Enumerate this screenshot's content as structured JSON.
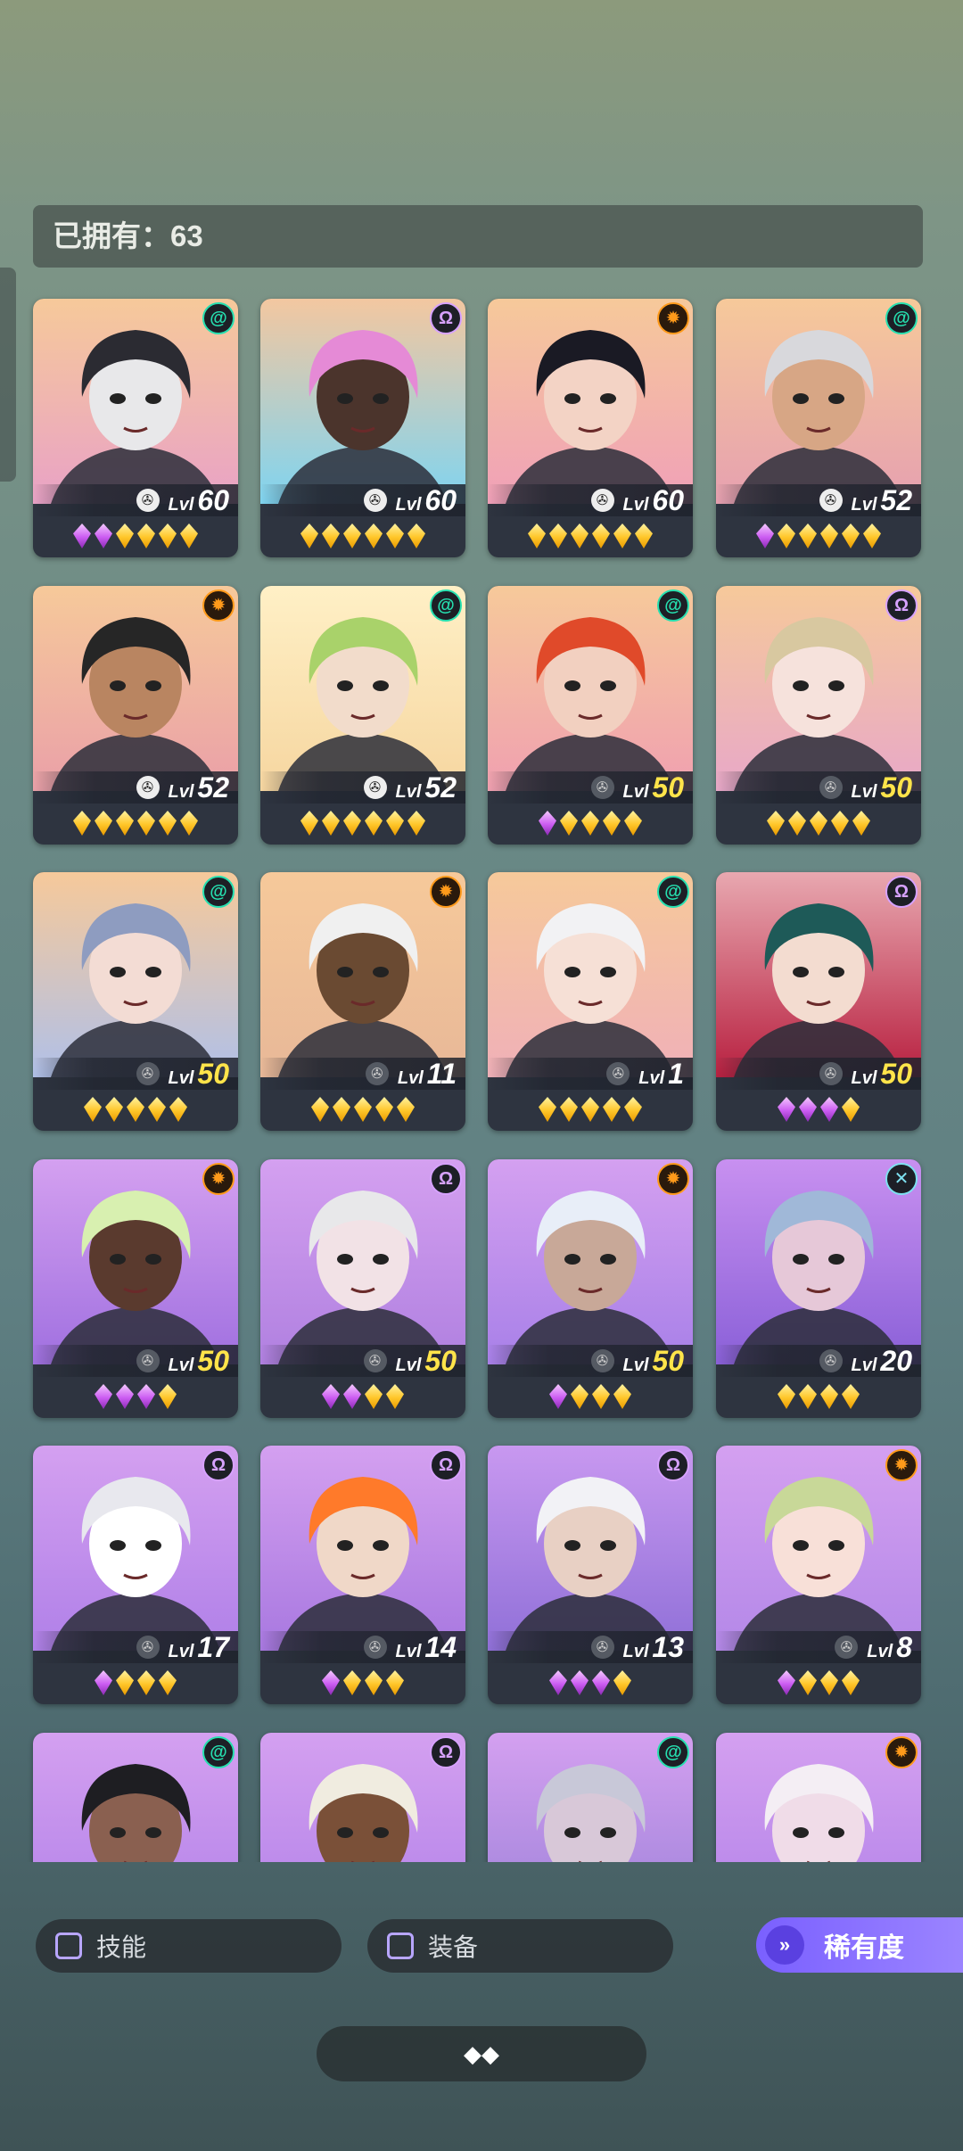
{
  "owned": {
    "label": "已拥有：",
    "count": "63"
  },
  "heroes": [
    {
      "faction": "spiral",
      "faction_color": "green",
      "level": "60",
      "lvl_label": "Lvl",
      "gold_level": false,
      "icon_active": true,
      "stars": [
        "purple",
        "purple",
        "gold",
        "gold",
        "gold",
        "gold"
      ],
      "bg": [
        "#f6c99a",
        "#e9a2c6"
      ],
      "skin": "#e8e8ea",
      "hair": "#2b2b32"
    },
    {
      "faction": "omega",
      "faction_color": "purple",
      "level": "60",
      "lvl_label": "Lvl",
      "gold_level": false,
      "icon_active": true,
      "stars": [
        "gold",
        "gold",
        "gold",
        "gold",
        "gold",
        "gold"
      ],
      "bg": [
        "#f3c7a0",
        "#7fd4f0"
      ],
      "skin": "#4b342c",
      "hair": "#e58ad6"
    },
    {
      "faction": "sun",
      "faction_color": "orange",
      "level": "60",
      "lvl_label": "Lvl",
      "gold_level": false,
      "icon_active": true,
      "stars": [
        "gold",
        "gold",
        "gold",
        "gold",
        "gold",
        "gold"
      ],
      "bg": [
        "#f6c99a",
        "#f0a0b8"
      ],
      "skin": "#f3d3c5",
      "hair": "#1a1a24"
    },
    {
      "faction": "spiral",
      "faction_color": "green",
      "level": "52",
      "lvl_label": "Lvl",
      "gold_level": false,
      "icon_active": true,
      "stars": [
        "purple",
        "gold",
        "gold",
        "gold",
        "gold",
        "gold"
      ],
      "bg": [
        "#f6c99a",
        "#e6a0b0"
      ],
      "skin": "#d7a685",
      "hair": "#d8d8dc"
    },
    {
      "faction": "sun",
      "faction_color": "orange",
      "level": "52",
      "lvl_label": "Lvl",
      "gold_level": false,
      "icon_active": true,
      "stars": [
        "gold",
        "gold",
        "gold",
        "gold",
        "gold",
        "gold"
      ],
      "bg": [
        "#f6c99a",
        "#eaa0a8"
      ],
      "skin": "#b98561",
      "hair": "#262626"
    },
    {
      "faction": "spiral",
      "faction_color": "green",
      "level": "52",
      "lvl_label": "Lvl",
      "gold_level": false,
      "icon_active": true,
      "stars": [
        "gold",
        "gold",
        "gold",
        "gold",
        "gold",
        "gold"
      ],
      "bg": [
        "#fff0c6",
        "#f6d6a0"
      ],
      "skin": "#f2dccb",
      "hair": "#a9d26a"
    },
    {
      "faction": "spiral",
      "faction_color": "green",
      "level": "50",
      "lvl_label": "Lvl",
      "gold_level": true,
      "icon_active": false,
      "stars": [
        "purple",
        "gold",
        "gold",
        "gold",
        "gold"
      ],
      "bg": [
        "#f6c99a",
        "#f0a0b0"
      ],
      "skin": "#f2d0c0",
      "hair": "#e04a2a"
    },
    {
      "faction": "omega",
      "faction_color": "purple",
      "level": "50",
      "lvl_label": "Lvl",
      "gold_level": true,
      "icon_active": false,
      "stars": [
        "gold",
        "gold",
        "gold",
        "gold",
        "gold"
      ],
      "bg": [
        "#f6c99a",
        "#e8a8c8"
      ],
      "skin": "#f6e2dc",
      "hair": "#d8c8a0"
    },
    {
      "faction": "spiral",
      "faction_color": "green",
      "level": "50",
      "lvl_label": "Lvl",
      "gold_level": true,
      "icon_active": false,
      "stars": [
        "gold",
        "gold",
        "gold",
        "gold",
        "gold"
      ],
      "bg": [
        "#f6c99a",
        "#b0c0e8"
      ],
      "skin": "#f3dcd4",
      "hair": "#8e9cc0"
    },
    {
      "faction": "sun",
      "faction_color": "orange",
      "level": "11",
      "lvl_label": "Lvl",
      "gold_level": false,
      "icon_active": false,
      "stars": [
        "gold",
        "gold",
        "gold",
        "gold",
        "gold"
      ],
      "bg": [
        "#f6c99a",
        "#e8b898"
      ],
      "skin": "#6a4a32",
      "hair": "#f0f0f0"
    },
    {
      "faction": "spiral",
      "faction_color": "green",
      "level": "1",
      "lvl_label": "Lvl",
      "gold_level": false,
      "icon_active": false,
      "stars": [
        "gold",
        "gold",
        "gold",
        "gold",
        "gold"
      ],
      "bg": [
        "#f6c99a",
        "#f0b0b8"
      ],
      "skin": "#f6e0d6",
      "hair": "#f2f2f4"
    },
    {
      "faction": "omega",
      "faction_color": "purple",
      "level": "50",
      "lvl_label": "Lvl",
      "gold_level": true,
      "icon_active": false,
      "stars": [
        "purple",
        "purple",
        "purple",
        "gold"
      ],
      "bg": [
        "#e8a8b0",
        "#b82040"
      ],
      "skin": "#f3dcd0",
      "hair": "#1e5a58"
    },
    {
      "faction": "sun",
      "faction_color": "orange",
      "level": "50",
      "lvl_label": "Lvl",
      "gold_level": true,
      "icon_active": false,
      "stars": [
        "purple",
        "purple",
        "purple",
        "gold"
      ],
      "bg": [
        "#d4a0f0",
        "#a070e0"
      ],
      "skin": "#5a3a2e",
      "hair": "#d8f0b0"
    },
    {
      "faction": "omega",
      "faction_color": "purple",
      "level": "50",
      "lvl_label": "Lvl",
      "gold_level": true,
      "icon_active": false,
      "stars": [
        "purple",
        "purple",
        "gold",
        "gold"
      ],
      "bg": [
        "#d4a0f0",
        "#b080e0"
      ],
      "skin": "#f2e2e6",
      "hair": "#e8e8ea"
    },
    {
      "faction": "sun",
      "faction_color": "orange",
      "level": "50",
      "lvl_label": "Lvl",
      "gold_level": true,
      "icon_active": false,
      "stars": [
        "purple",
        "gold",
        "gold",
        "gold"
      ],
      "bg": [
        "#d4a0f0",
        "#a880e8"
      ],
      "skin": "#c8a898",
      "hair": "#e8eef8"
    },
    {
      "faction": "cross",
      "faction_color": "teal",
      "level": "20",
      "lvl_label": "Lvl",
      "gold_level": false,
      "icon_active": false,
      "stars": [
        "gold",
        "gold",
        "gold",
        "gold"
      ],
      "bg": [
        "#c890f0",
        "#8a60d8"
      ],
      "skin": "#e6c8d8",
      "hair": "#a0b8d8"
    },
    {
      "faction": "omega",
      "faction_color": "purple",
      "level": "17",
      "lvl_label": "Lvl",
      "gold_level": false,
      "icon_active": false,
      "stars": [
        "purple",
        "gold",
        "gold",
        "gold"
      ],
      "bg": [
        "#d4a0f0",
        "#b080e8"
      ],
      "skin": "#ffffff",
      "hair": "#e8e8ee"
    },
    {
      "faction": "omega",
      "faction_color": "purple",
      "level": "14",
      "lvl_label": "Lvl",
      "gold_level": false,
      "icon_active": false,
      "stars": [
        "purple",
        "gold",
        "gold",
        "gold"
      ],
      "bg": [
        "#d4a0f0",
        "#a878e0"
      ],
      "skin": "#f0d8c8",
      "hair": "#ff7a2a"
    },
    {
      "faction": "omega",
      "faction_color": "purple",
      "level": "13",
      "lvl_label": "Lvl",
      "gold_level": false,
      "icon_active": false,
      "stars": [
        "purple",
        "purple",
        "purple",
        "gold"
      ],
      "bg": [
        "#c898f0",
        "#9070d8"
      ],
      "skin": "#e8d0c4",
      "hair": "#f2f2f6"
    },
    {
      "faction": "sun",
      "faction_color": "orange",
      "level": "8",
      "lvl_label": "Lvl",
      "gold_level": false,
      "icon_active": false,
      "stars": [
        "purple",
        "gold",
        "gold",
        "gold"
      ],
      "bg": [
        "#d4a0f0",
        "#b488e8"
      ],
      "skin": "#f8e0d8",
      "hair": "#c8d898"
    },
    {
      "faction": "spiral",
      "faction_color": "green",
      "level": "",
      "lvl_label": "",
      "gold_level": false,
      "icon_active": false,
      "stars": [],
      "bg": [
        "#d4a0f0",
        "#b080e8"
      ],
      "skin": "#8a6050",
      "hair": "#1e1e22"
    },
    {
      "faction": "omega",
      "faction_color": "purple",
      "level": "",
      "lvl_label": "",
      "gold_level": false,
      "icon_active": false,
      "stars": [],
      "bg": [
        "#d4a0f0",
        "#b080e8"
      ],
      "skin": "#7a5038",
      "hair": "#f0ece0"
    },
    {
      "faction": "spiral",
      "faction_color": "green",
      "level": "",
      "lvl_label": "",
      "gold_level": false,
      "icon_active": false,
      "stars": [],
      "bg": [
        "#d4a0f0",
        "#9a80d8"
      ],
      "skin": "#d8c8d8",
      "hair": "#c8c8d8"
    },
    {
      "faction": "sun",
      "faction_color": "orange",
      "level": "",
      "lvl_label": "",
      "gold_level": false,
      "icon_active": false,
      "stars": [],
      "bg": [
        "#d4a0f0",
        "#b080e8"
      ],
      "skin": "#f0dce8",
      "hair": "#f4eef4"
    }
  ],
  "filters": {
    "skill": "技能",
    "equip": "装备",
    "rarity": "稀有度"
  },
  "colors": {
    "accent": "#8a72ff",
    "gold_level": "#ffe44a"
  }
}
